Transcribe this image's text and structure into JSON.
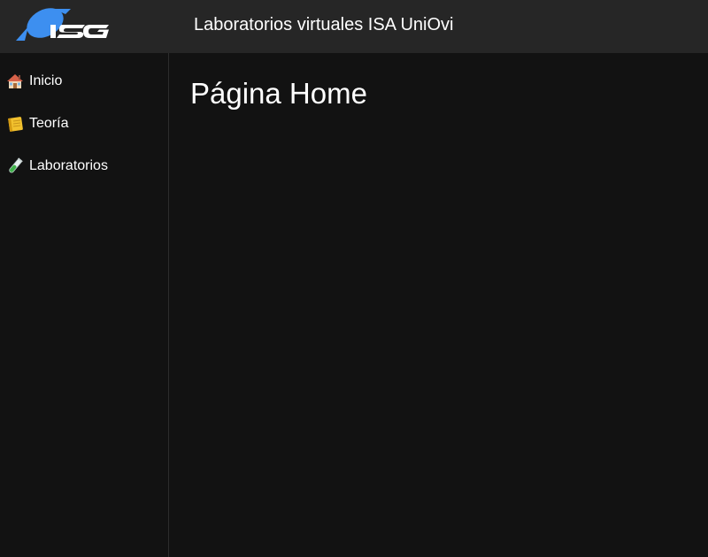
{
  "header": {
    "title": "Laboratorios virtuales ISA UniOvi",
    "logo": {
      "name": "isa-logo",
      "text": "ISG",
      "accent": "#3d8ff0"
    }
  },
  "sidebar": {
    "items": [
      {
        "label": "Inicio",
        "icon": "house-icon"
      },
      {
        "label": "Teoría",
        "icon": "notebook-icon"
      },
      {
        "label": "Laboratorios",
        "icon": "test-tube-icon"
      }
    ]
  },
  "main": {
    "title": "Página Home"
  },
  "colors": {
    "header_bg": "#262626",
    "page_bg": "#121212",
    "text": "#ffffff",
    "logo_blue": "#3d8ff0"
  }
}
